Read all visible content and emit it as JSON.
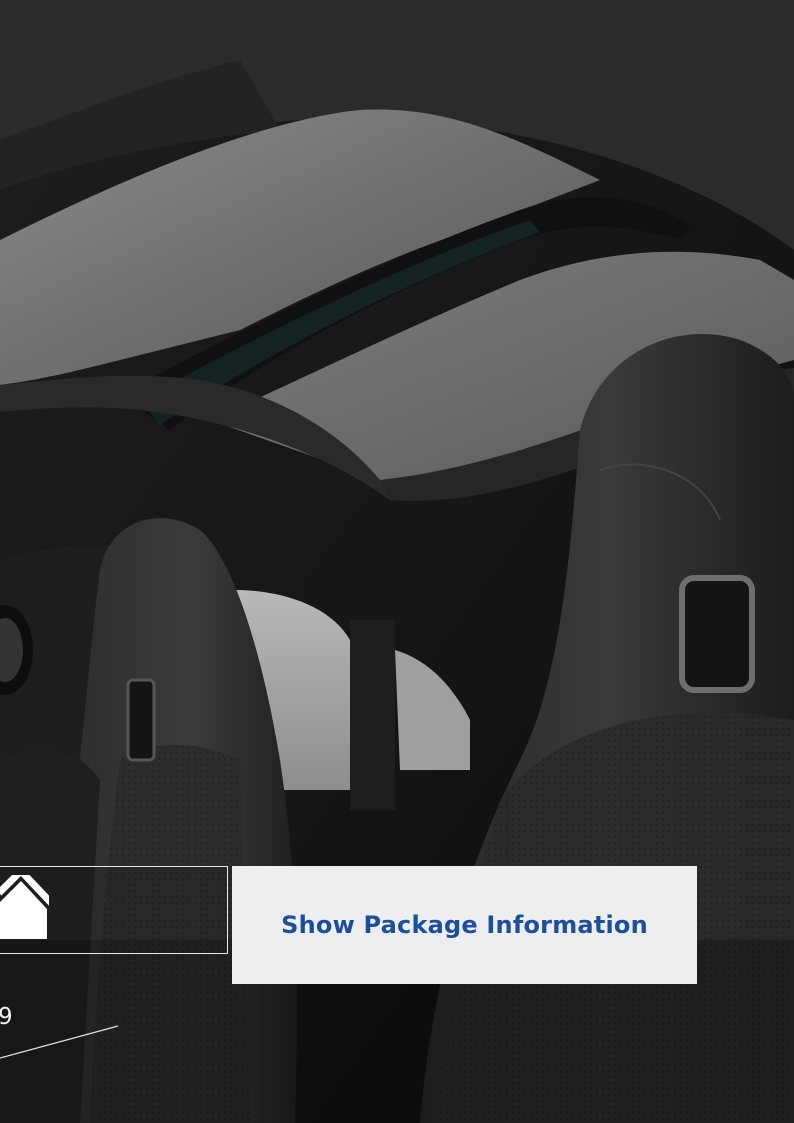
{
  "page": {
    "package_button_label": "Show Package Information",
    "page_number": "9"
  },
  "icons": {
    "home": "home-icon"
  },
  "colors": {
    "button_background": "#eceef0",
    "button_text": "#1c4e9c",
    "frame_border": "#e8e8e8",
    "page_number": "#f2f2f2"
  }
}
